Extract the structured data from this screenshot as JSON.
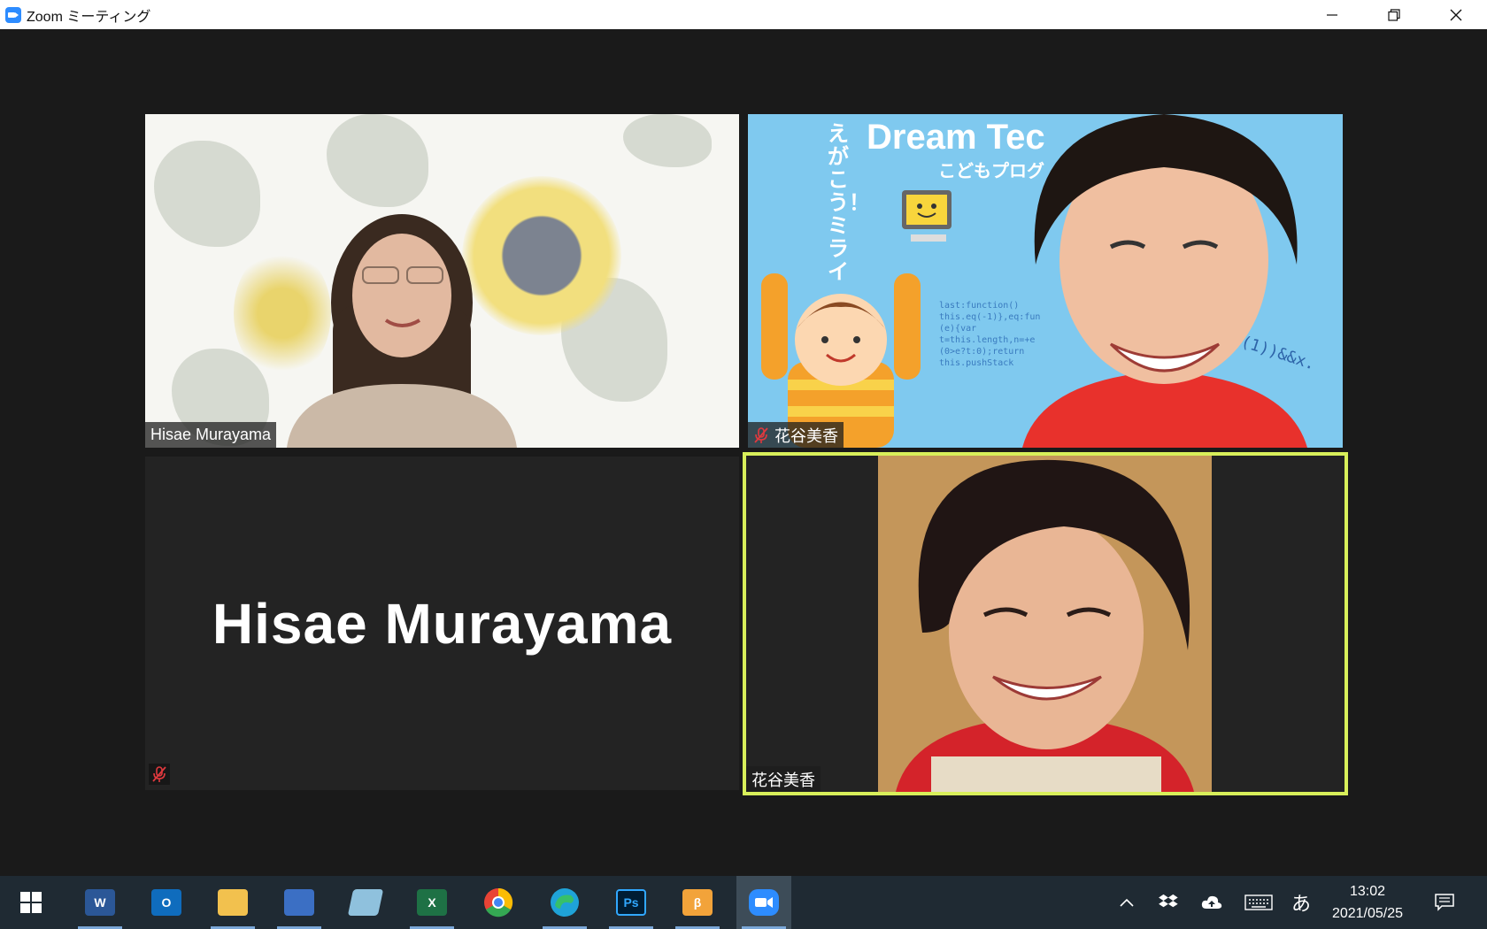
{
  "window": {
    "title": "Zoom ミーティング",
    "controls": [
      "minimize",
      "restore",
      "close"
    ]
  },
  "participants": [
    {
      "name": "Hisae Murayama",
      "video": true,
      "muted": false,
      "background": "sunflower"
    },
    {
      "name": "花谷美香",
      "video": true,
      "muted": true,
      "background": "Dream Tech banner"
    },
    {
      "name": "Hisae Murayama",
      "video": false,
      "muted": true
    },
    {
      "name": "花谷美香",
      "video": true,
      "muted": false,
      "active_speaker": true
    }
  ],
  "banner": {
    "title": "Dream Tec",
    "subtitle": "こどもプログ",
    "vertical_text": "えがこう！ミライ",
    "code": "last:function()\nthis.eq(-1)},eq:fun\n(e){var\nt=this.length,n=+e\n(0>e?t:0);return\nthis.pushStack",
    "code2": "r(1))&&x."
  },
  "taskbar": {
    "apps": [
      {
        "name": "windows-start",
        "label": ""
      },
      {
        "name": "word",
        "label": "W",
        "color": "#2b5797"
      },
      {
        "name": "outlook",
        "label": "O",
        "color": "#0f6cbd"
      },
      {
        "name": "file-explorer",
        "label": "",
        "color": "#f2c14e"
      },
      {
        "name": "mail",
        "label": "",
        "color": "#3b6fc4"
      },
      {
        "name": "notepad",
        "label": "",
        "color": "#8fc1dd"
      },
      {
        "name": "excel",
        "label": "X",
        "color": "#1e7145"
      },
      {
        "name": "chrome",
        "label": "",
        "color": "#e84335"
      },
      {
        "name": "edge",
        "label": "",
        "color": "#1fa3d8"
      },
      {
        "name": "photoshop",
        "label": "Ps",
        "color": "#001d34"
      },
      {
        "name": "brave-app",
        "label": "β",
        "color": "#f2a33a"
      },
      {
        "name": "zoom",
        "label": "",
        "color": "#2d8cff"
      }
    ],
    "tray_ime": "あ",
    "time": "13:02",
    "date": "2021/05/25"
  }
}
